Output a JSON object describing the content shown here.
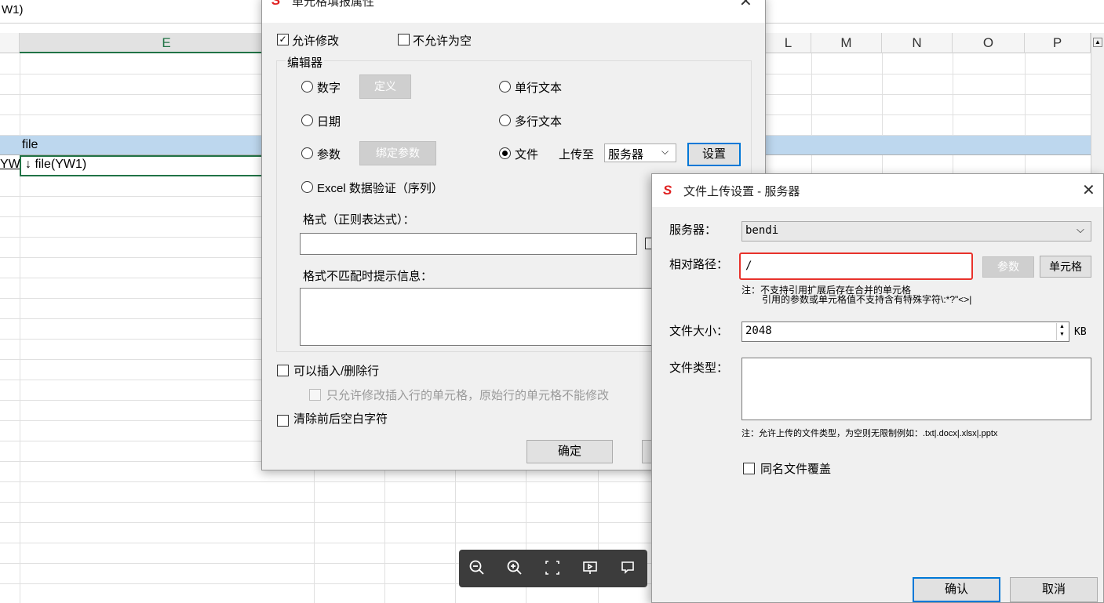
{
  "sheet": {
    "formula_text": "W1)",
    "columns": [
      "E",
      "L",
      "M",
      "N",
      "O",
      "P"
    ],
    "cell_file": "file",
    "cell_left_fragment": "YW",
    "cell_active": "↓ file(YW1)"
  },
  "dialog1": {
    "title": "单元格填报属性",
    "allow_edit": "允许修改",
    "not_null": "不允许为空",
    "editor_group": "编辑器",
    "opt_number": "数字",
    "btn_define": "定义",
    "opt_date": "日期",
    "opt_param": "参数",
    "btn_bind_param": "绑定参数",
    "opt_excel": "Excel 数据验证（序列）",
    "opt_single_text": "单行文本",
    "opt_multi_text": "多行文本",
    "opt_file": "文件",
    "upload_to": "上传至",
    "upload_target": "服务器",
    "btn_settings": "设置",
    "format_label": "格式（正则表达式）：",
    "mismatch_label": "格式不匹配时提示信息：",
    "insert_delete": "可以插入/删除行",
    "insert_only_note": "只允许修改插入行的单元格，原始行的单元格不能修改",
    "trim_blank": "清除前后空白字符",
    "btn_ok": "确定"
  },
  "dialog2": {
    "title": "文件上传设置 - 服务器",
    "server_label": "服务器：",
    "server_value": "bendi",
    "path_label": "相对路径：",
    "path_value": "/",
    "btn_param": "参数",
    "btn_cell": "单元格",
    "note1_a": "注：不支持引用扩展后存在合并的单元格",
    "note1_b": "引用的参数或单元格值不支持含有特殊字符\\:*?\"<>|",
    "size_label": "文件大小：",
    "size_value": "2048",
    "size_unit": "KB",
    "type_label": "文件类型：",
    "note2": "注：允许上传的文件类型，为空则无限制例如：.txt|.docx|.xlsx|.pptx",
    "overwrite_label": "同名文件覆盖",
    "btn_confirm": "确认",
    "btn_cancel": "取消"
  },
  "viewer_icons": [
    "zoom-out-icon",
    "zoom-in-icon",
    "fit-screen-icon",
    "slideshow-icon",
    "comment-icon"
  ],
  "colors": {
    "excel_green": "#217346",
    "selection_blue": "#bdd7ee",
    "highlight_red": "#e8322b",
    "logo_red": "#e02020",
    "primary_blue": "#0078d7"
  }
}
